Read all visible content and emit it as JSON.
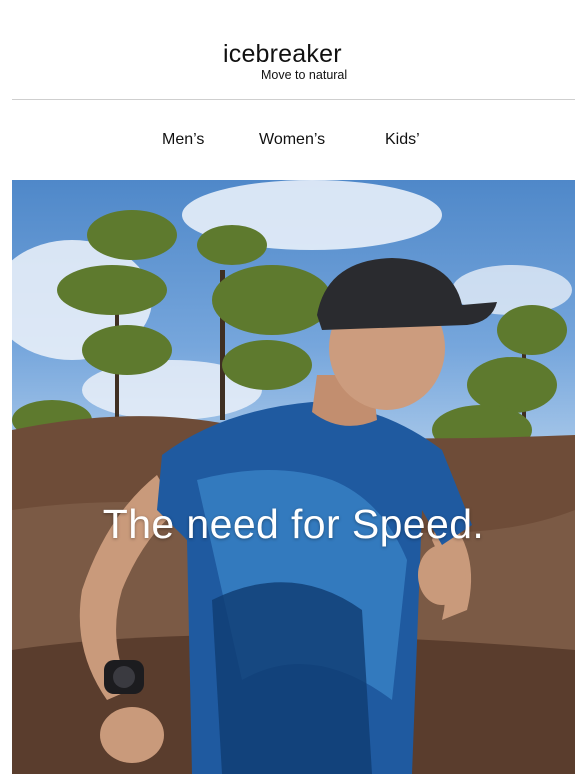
{
  "brand": {
    "name": "icebreaker",
    "tagline": "Move to natural"
  },
  "nav": {
    "items": [
      "Men’s",
      "Women’s",
      "Kids’"
    ]
  },
  "hero": {
    "headline": "The need for Speed.",
    "image": "runner-in-forest-photo"
  }
}
